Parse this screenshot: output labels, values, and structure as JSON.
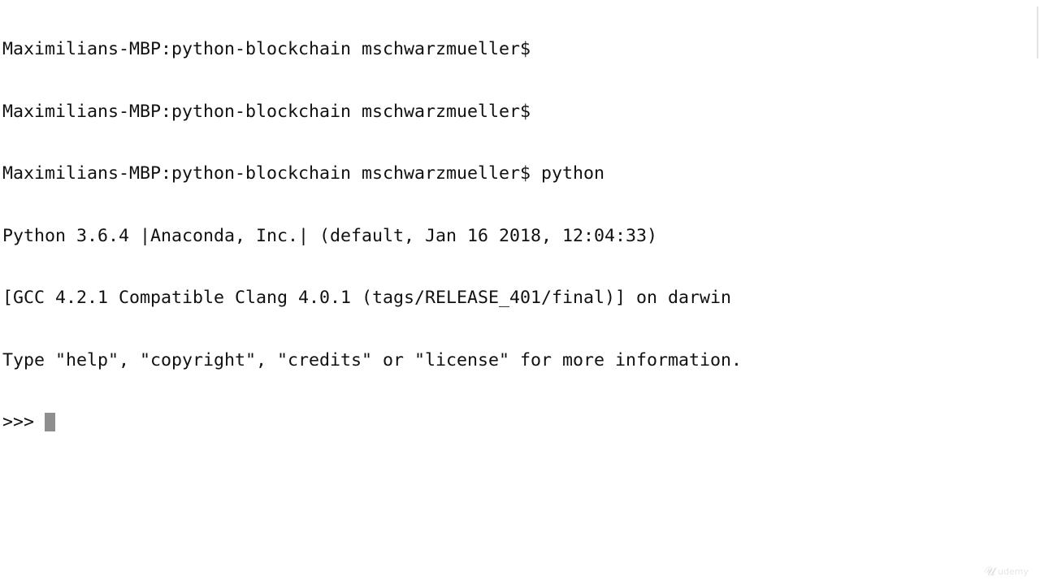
{
  "terminal": {
    "lines": [
      "Maximilians-MBP:python-blockchain mschwarzmueller$",
      "Maximilians-MBP:python-blockchain mschwarzmueller$",
      "Maximilians-MBP:python-blockchain mschwarzmueller$ python",
      "Python 3.6.4 |Anaconda, Inc.| (default, Jan 16 2018, 12:04:33)",
      "[GCC 4.2.1 Compatible Clang 4.0.1 (tags/RELEASE_401/final)] on darwin",
      "Type \"help\", \"copyright\", \"credits\" or \"license\" for more information."
    ],
    "prompt": ">>> ",
    "cursor_color": "#8e8e8e"
  },
  "watermark": {
    "icon": "udemy-logo-icon",
    "text": "udemy"
  }
}
